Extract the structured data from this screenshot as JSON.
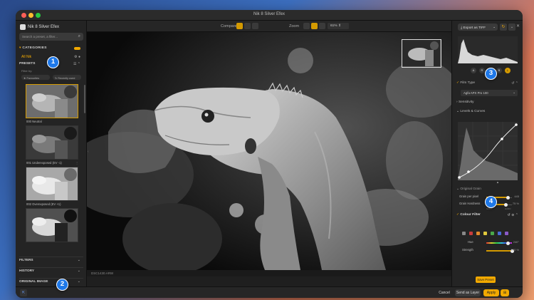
{
  "window": {
    "title": "Nik 8 Silver Efex"
  },
  "app": {
    "name": "Nik 8 Silver Efex"
  },
  "search": {
    "placeholder": "Search a preset, a filter..."
  },
  "categories": {
    "label": "CATEGORIES",
    "all_label": "All Nik"
  },
  "presets": {
    "label": "PRESETS",
    "filter_by": "Filter by:",
    "filter_chips": [
      "Favourites",
      "Recently used"
    ],
    "items": [
      {
        "label": "000 Neutral",
        "selected": true
      },
      {
        "label": "001 Underexposed (EV -1)",
        "selected": false
      },
      {
        "label": "002 Overexposed (EV +1)",
        "selected": false
      },
      {
        "label": "",
        "selected": false
      }
    ]
  },
  "left_sections": [
    "FILTERS",
    "HISTORY",
    "ORIGINAL IMAGE"
  ],
  "toolbar": {
    "compare_label": "Compare",
    "zoom_label": "Zoom",
    "zoom_value": "61%"
  },
  "image": {
    "filename": "DSC1430.ARW"
  },
  "right": {
    "export_label": "Export as TIFF",
    "channels": [
      "A",
      "R",
      "G",
      "B",
      "L"
    ],
    "film_type": {
      "label": "Film Type",
      "selected": "Agfa APX Pro 100"
    },
    "sensitivity_label": "Sensitivity",
    "levels_label": "Levels & Curves",
    "original_grain_label": "Original Grain",
    "grain_per_pixel": {
      "label": "Grain per pixel",
      "value": "445"
    },
    "grain_hardness": {
      "label": "Grain Hardness",
      "value": "75 %",
      "soft": "SOFT",
      "hard": "HARD"
    },
    "colour_filter_label": "Colour Filter",
    "hue": {
      "label": "Hue",
      "value": "240°"
    },
    "strength": {
      "label": "Strength",
      "value": "200 %"
    },
    "save_preset": "Save Preset"
  },
  "bottom": {
    "cancel": "Cancel",
    "send_layer": "Send as Layer",
    "apply": "Apply"
  },
  "badges": [
    "1",
    "2",
    "3",
    "4"
  ],
  "colors": {
    "accent": "#f2a900",
    "badge": "#1e78e8",
    "background": "#1f1f1f"
  }
}
